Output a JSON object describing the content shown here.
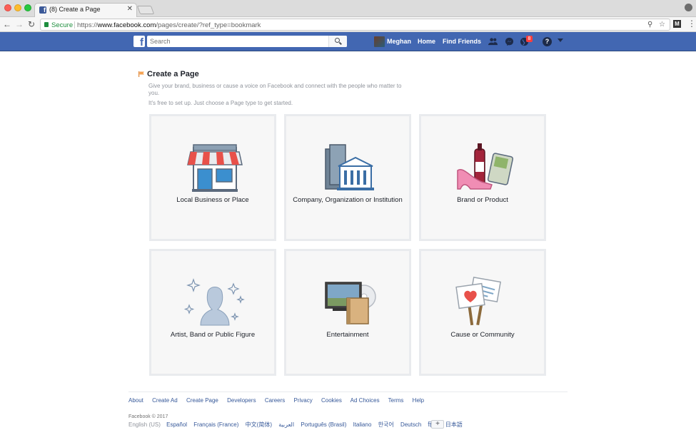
{
  "browser": {
    "tab_title": "(8) Create a Page",
    "tab_close": "✕",
    "secure_label": "Secure",
    "url_scheme": "https://",
    "url_host": "www.facebook.com",
    "url_path": "/pages/create/?ref_type=bookmark"
  },
  "fb_header": {
    "search_placeholder": "Search",
    "user_name": "Meghan",
    "nav_home": "Home",
    "nav_find_friends": "Find Friends",
    "notifications_count": "8",
    "help_glyph": "?",
    "brand_color": "#4267b2"
  },
  "content": {
    "title": "Create a Page",
    "intro": "Give your brand, business or cause a voice on Facebook and connect with the people who matter to you.",
    "intro2": "It's free to set up. Just choose a Page type to get started.",
    "page_types": [
      {
        "label": "Local Business or Place",
        "icon": "storefront-icon"
      },
      {
        "label": "Company, Organization or Institution",
        "icon": "office-building-icon"
      },
      {
        "label": "Brand or Product",
        "icon": "products-icon"
      },
      {
        "label": "Artist, Band or Public Figure",
        "icon": "silhouette-star-icon"
      },
      {
        "label": "Entertainment",
        "icon": "tv-book-icon"
      },
      {
        "label": "Cause or Community",
        "icon": "protest-signs-icon"
      }
    ]
  },
  "footer": {
    "links": [
      "About",
      "Create Ad",
      "Create Page",
      "Developers",
      "Careers",
      "Privacy",
      "Cookies",
      "Ad Choices",
      "Terms",
      "Help"
    ],
    "copyright": "Facebook © 2017",
    "current_language": "English (US)",
    "languages": [
      "Español",
      "Français (France)",
      "中文(简体)",
      "العربية",
      "Português (Brasil)",
      "Italiano",
      "한국어",
      "Deutsch",
      "हिन्दी",
      "日本語"
    ],
    "more_languages": "+"
  }
}
